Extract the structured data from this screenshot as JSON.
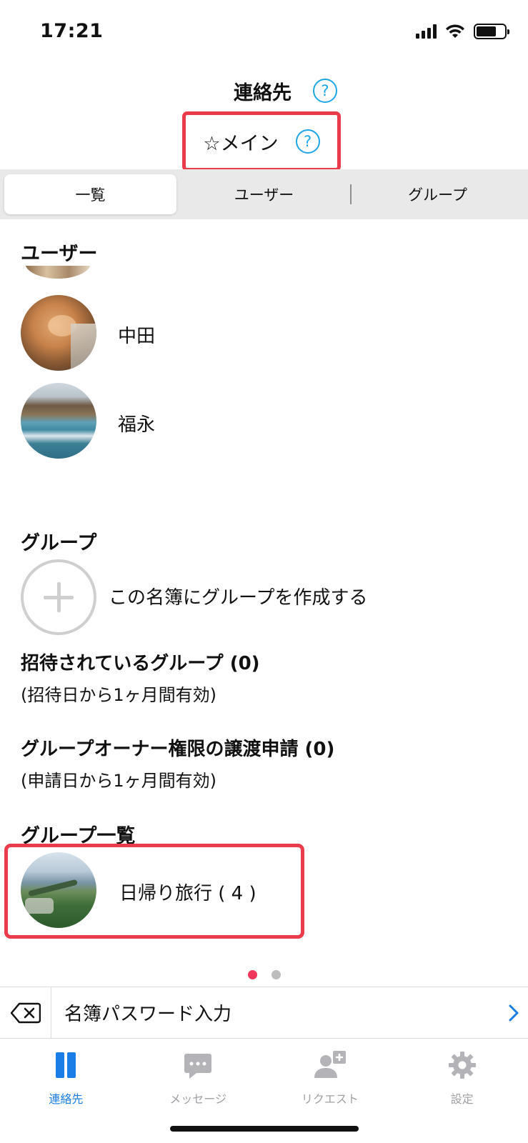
{
  "status": {
    "time": "17:21"
  },
  "header": {
    "title": "連絡先",
    "help": "?",
    "roster_name": "☆メイン",
    "roster_help": "?"
  },
  "tabs": [
    {
      "label": "一覧",
      "active": true
    },
    {
      "label": "ユーザー",
      "active": false
    },
    {
      "label": "グループ",
      "active": false
    }
  ],
  "users": {
    "heading": "ユーザー",
    "items": [
      {
        "name": "中田"
      },
      {
        "name": "福永"
      }
    ]
  },
  "groups": {
    "heading": "グループ",
    "create_label": "この名簿にグループを作成する",
    "invited_title": "招待されているグループ (0)",
    "invited_note": "(招待日から1ヶ月間有効)",
    "transfer_title": "グループオーナー権限の譲渡申請 (0)",
    "transfer_note": "(申請日から1ヶ月間有効)",
    "list_heading": "グループ一覧",
    "list": [
      {
        "name": "日帰り旅行 ( 4 )"
      }
    ]
  },
  "pager": {
    "count": 2,
    "current": 1
  },
  "password_row": {
    "label": "名簿パスワード入力"
  },
  "tab_bar": [
    {
      "label": "連絡先",
      "icon": "contacts-icon",
      "active": true
    },
    {
      "label": "メッセージ",
      "icon": "message-icon",
      "active": false
    },
    {
      "label": "リクエスト",
      "icon": "request-icon",
      "active": false
    },
    {
      "label": "設定",
      "icon": "gear-icon",
      "active": false
    }
  ],
  "colors": {
    "accent": "#1a7ee6",
    "highlight": "#ea3b4a",
    "help": "#1ea6e6",
    "pager_active": "#f0365a"
  }
}
